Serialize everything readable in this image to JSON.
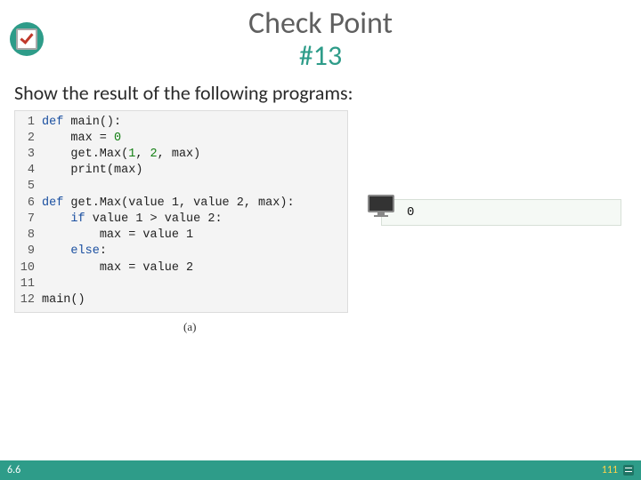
{
  "header": {
    "title_line1": "Check Point",
    "title_line2": "#13"
  },
  "subtitle": "Show the result of the following programs:",
  "code": {
    "line_count": 12,
    "lines": [
      {
        "indent": 0,
        "tokens": [
          [
            "kw",
            "def"
          ],
          [
            "",
            ""
          ],
          [
            "",
            "main():"
          ]
        ]
      },
      {
        "indent": 1,
        "tokens": [
          [
            "",
            "max = "
          ],
          [
            "num",
            "0"
          ]
        ]
      },
      {
        "indent": 1,
        "tokens": [
          [
            "",
            "get.Max("
          ],
          [
            "num",
            "1"
          ],
          [
            "",
            ", "
          ],
          [
            "num",
            "2"
          ],
          [
            "",
            ", max)"
          ]
        ]
      },
      {
        "indent": 1,
        "tokens": [
          [
            "",
            "print(max)"
          ]
        ]
      },
      {
        "indent": 0,
        "tokens": []
      },
      {
        "indent": 0,
        "tokens": [
          [
            "kw",
            "def"
          ],
          [
            "",
            ""
          ],
          [
            "",
            "get.Max(value 1, value 2, max):"
          ]
        ]
      },
      {
        "indent": 1,
        "tokens": [
          [
            "kw",
            "if"
          ],
          [
            "",
            ""
          ],
          [
            "",
            "value 1 > value 2:"
          ]
        ]
      },
      {
        "indent": 2,
        "tokens": [
          [
            "",
            "max = value 1"
          ]
        ]
      },
      {
        "indent": 1,
        "tokens": [
          [
            "kw",
            "else"
          ],
          [
            "",
            ":"
          ]
        ]
      },
      {
        "indent": 2,
        "tokens": [
          [
            "",
            "max = value 2"
          ]
        ]
      },
      {
        "indent": 0,
        "tokens": []
      },
      {
        "indent": 0,
        "tokens": [
          [
            "",
            "main()"
          ]
        ]
      }
    ],
    "label": "(a)"
  },
  "output": {
    "value": "0"
  },
  "footer": {
    "section": "6.6",
    "page": "111"
  }
}
